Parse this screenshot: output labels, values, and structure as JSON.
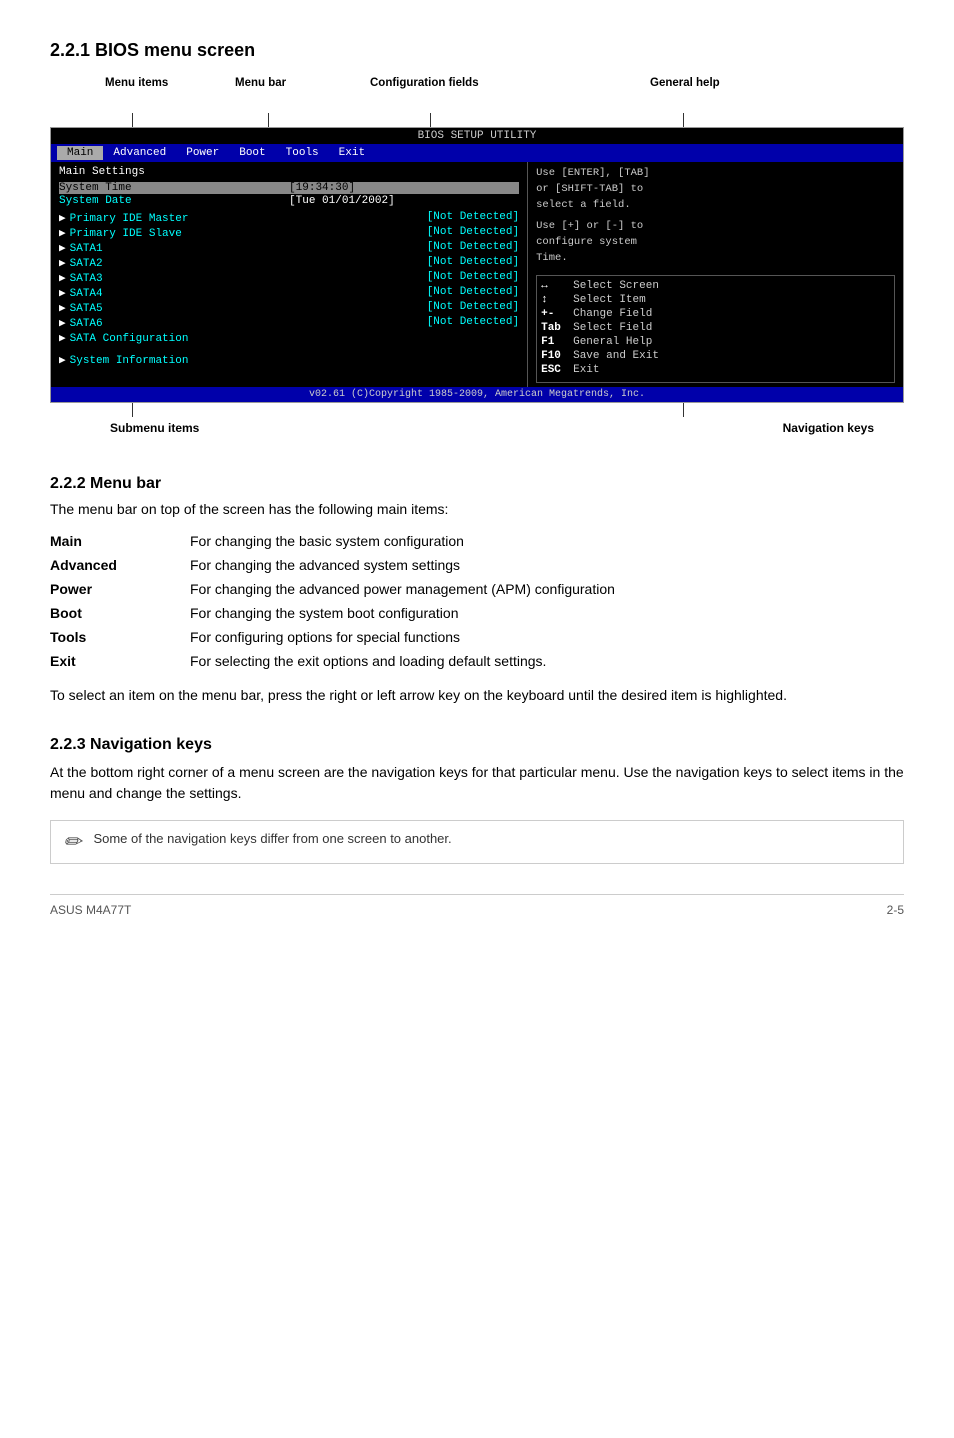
{
  "page": {
    "section221": {
      "title": "2.2.1    BIOS menu screen"
    },
    "section222": {
      "title": "2.2.2    Menu bar",
      "intro": "The menu bar on top of the screen has the following main items:",
      "items": [
        {
          "label": "Main",
          "desc": "For changing the basic system configuration"
        },
        {
          "label": "Advanced",
          "desc": "For changing the advanced system settings"
        },
        {
          "label": "Power",
          "desc": "For changing the advanced power management (APM) configuration"
        },
        {
          "label": "Boot",
          "desc": "For changing the system boot configuration"
        },
        {
          "label": "Tools",
          "desc": "For configuring options for special functions"
        },
        {
          "label": "Exit",
          "desc": "For selecting the exit options and loading default settings."
        }
      ],
      "body": "To select an item on the menu bar, press the right or left arrow key on the keyboard until the desired item is highlighted."
    },
    "section223": {
      "title": "2.2.3    Navigation keys",
      "body": "At the bottom right corner of a menu screen are the navigation keys for that particular menu. Use the navigation keys to select items in the menu and change the settings.",
      "note": "Some of the navigation keys differ from one screen to another."
    }
  },
  "diagram": {
    "labels": {
      "menu_items": "Menu items",
      "menu_bar": "Menu bar",
      "config_fields": "Configuration fields",
      "general_help": "General help",
      "submenu_items": "Submenu items",
      "navigation_keys": "Navigation keys"
    },
    "bios": {
      "title": "BIOS SETUP UTILITY",
      "menu_items": [
        "Main",
        "Advanced",
        "Power",
        "Boot",
        "Tools",
        "Exit"
      ],
      "active_menu": "Main",
      "section": "Main Settings",
      "highlighted": "System Time",
      "fields": [
        {
          "label": "System Time",
          "value": "[19:34:30]"
        },
        {
          "label": "System Date",
          "value": "[Tue 01/01/2002]"
        }
      ],
      "items": [
        "Primary IDE Master",
        "Primary IDE Slave",
        "SATA1",
        "SATA2",
        "SATA3",
        "SATA4",
        "SATA5",
        "SATA6",
        "SATA Configuration",
        "System Information"
      ],
      "item_values": [
        "[Not Detected]",
        "[Not Detected]",
        "[Not Detected]",
        "[Not Detected]",
        "[Not Detected]",
        "[Not Detected]",
        "[Not Detected]",
        "[Not Detected]",
        "",
        ""
      ],
      "help_text": [
        "Use [ENTER], [TAB]",
        "or [SHIFT-TAB] to",
        "select a field.",
        "",
        "Use [+] or [-] to",
        "configure system",
        "Time."
      ],
      "nav_keys": [
        {
          "key": "↔",
          "desc": "Select Screen"
        },
        {
          "key": "↕",
          "desc": "Select Item"
        },
        {
          "key": "+-",
          "desc": "Change Field"
        },
        {
          "key": "Tab",
          "desc": "Select Field"
        },
        {
          "key": "F1",
          "desc": "General Help"
        },
        {
          "key": "F10",
          "desc": "Save and Exit"
        },
        {
          "key": "ESC",
          "desc": "Exit"
        }
      ],
      "footer": "v02.61  (C)Copyright 1985-2009, American Megatrends, Inc."
    }
  },
  "footer": {
    "model": "ASUS M4A77T",
    "page": "2-5"
  }
}
